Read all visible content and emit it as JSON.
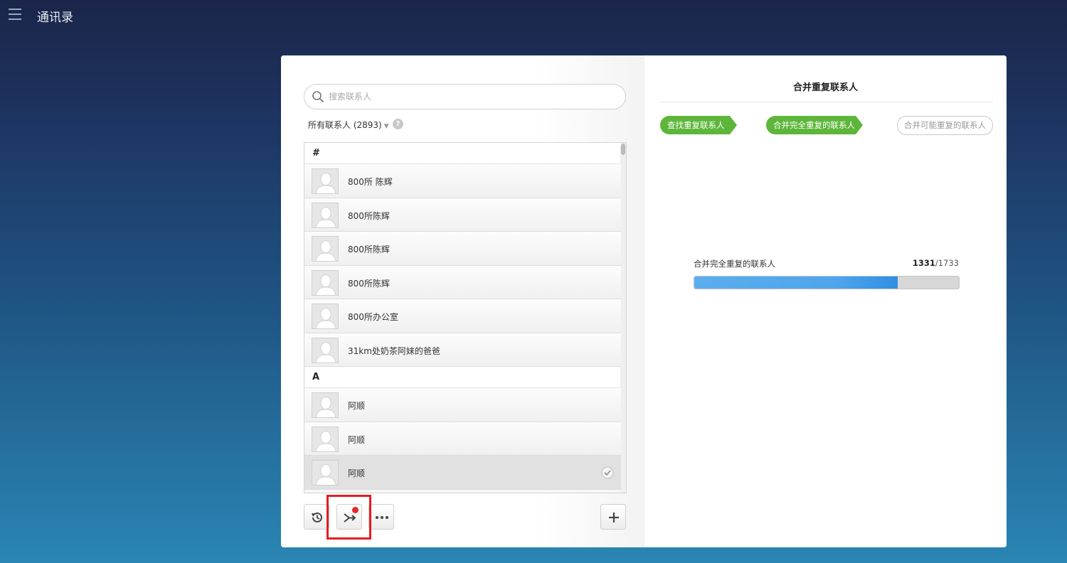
{
  "app": {
    "title": "通讯录"
  },
  "search": {
    "placeholder": "搜索联系人",
    "value": ""
  },
  "filter": {
    "label": "所有联系人 (2893)",
    "help": "?"
  },
  "list": {
    "sections": [
      {
        "header": "#",
        "contacts": [
          {
            "name": "800所 陈辉",
            "selected": false
          },
          {
            "name": "800所陈辉",
            "selected": false
          },
          {
            "name": "800所陈辉",
            "selected": false
          },
          {
            "name": "800所陈辉",
            "selected": false
          },
          {
            "name": "800所办公室",
            "selected": false
          },
          {
            "name": "31km处奶茶阿妹的爸爸",
            "selected": false
          }
        ]
      },
      {
        "header": "A",
        "contacts": [
          {
            "name": "阿顺",
            "selected": false
          },
          {
            "name": "阿顺",
            "selected": false
          },
          {
            "name": "阿顺",
            "selected": true
          }
        ]
      }
    ]
  },
  "toolbar": {
    "history_icon": "history-icon",
    "merge_icon": "merge-icon",
    "more_icon": "more-icon",
    "add_icon": "plus-icon",
    "merge_has_notification": true
  },
  "merge_panel": {
    "title": "合并重复联系人",
    "steps": [
      {
        "label": "查找重复联系人",
        "status": "done"
      },
      {
        "label": "合并完全重复的联系人",
        "status": "active"
      },
      {
        "label": "合并可能重复的联系人",
        "status": "pending"
      }
    ],
    "progress": {
      "label": "合并完全重复的联系人",
      "current": "1331",
      "separator": "/",
      "total": "1733",
      "fraction": 0.768
    }
  },
  "colors": {
    "step_green": "#5db63a",
    "progress_blue": "#4ea5ec",
    "highlight_red": "#e31e24",
    "notification_red": "#e8262b"
  }
}
